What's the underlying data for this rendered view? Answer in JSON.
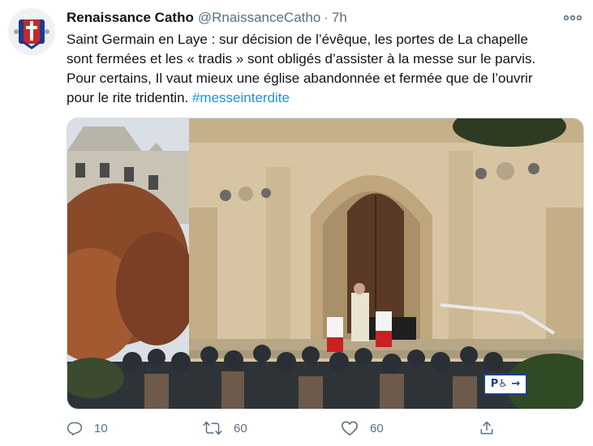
{
  "tweet": {
    "author_name": "Renaissance Catho",
    "handle": "@RnaissanceCatho",
    "separator": "·",
    "time": "7h",
    "text_lines": [
      "Saint Germain en Laye : sur décision de l’évêque, les portes de La chapelle",
      "sont fermées et les « tradis » sont obligés d’assister à la messe sur le parvis.",
      "Pour certains, Il vaut mieux une église abandonnée et fermée que de l’ouvrir",
      "pour le rite tridentin. "
    ],
    "hashtag": "#messeinterdite",
    "media": {
      "description_icon": "photo",
      "sign_text": "P♿ →"
    },
    "actions": {
      "reply_count": "10",
      "retweet_count": "60",
      "like_count": "60"
    }
  },
  "colors": {
    "text": "#0f1419",
    "secondary": "#5b7083",
    "link": "#1b95e0",
    "border": "#d6dde3"
  },
  "icons": [
    "avatar-logo",
    "more-icon",
    "reply-icon",
    "retweet-icon",
    "like-icon",
    "share-icon"
  ]
}
